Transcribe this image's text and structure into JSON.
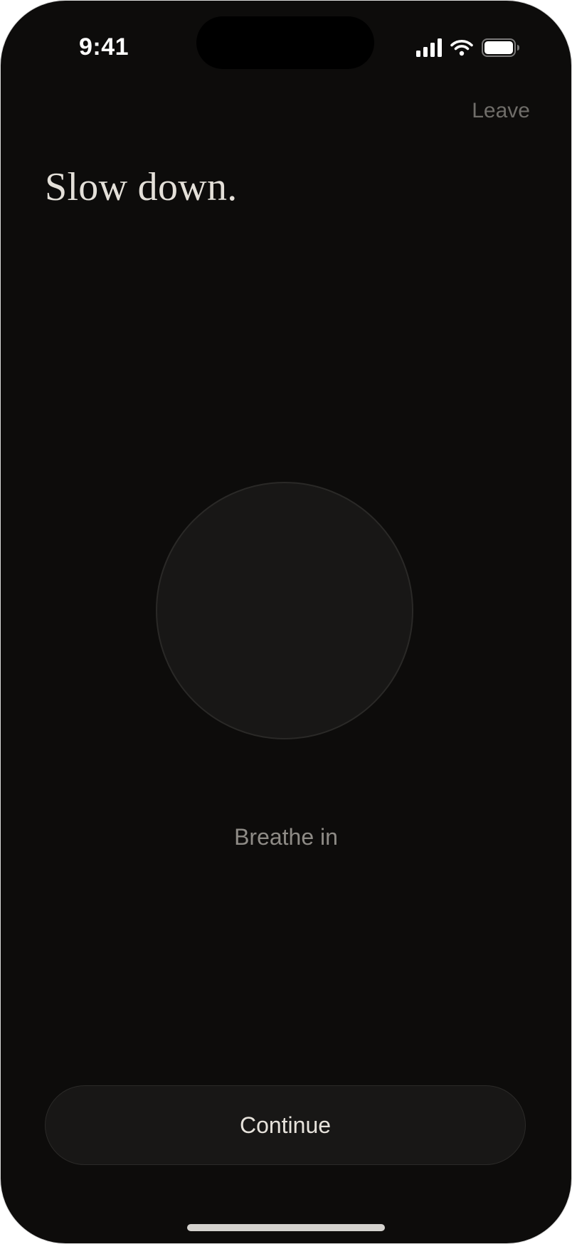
{
  "status_bar": {
    "time": "9:41",
    "icons": [
      "cellular-signal-icon",
      "wifi-icon",
      "battery-icon"
    ]
  },
  "header": {
    "leave_label": "Leave",
    "title": "Slow down."
  },
  "breathing": {
    "phase_label": "Breathe in"
  },
  "footer": {
    "continue_label": "Continue"
  },
  "colors": {
    "background": "#0d0c0b",
    "circle_fill": "#181716",
    "title_text": "#e4e0d9",
    "muted_text": "#6f6d69"
  }
}
